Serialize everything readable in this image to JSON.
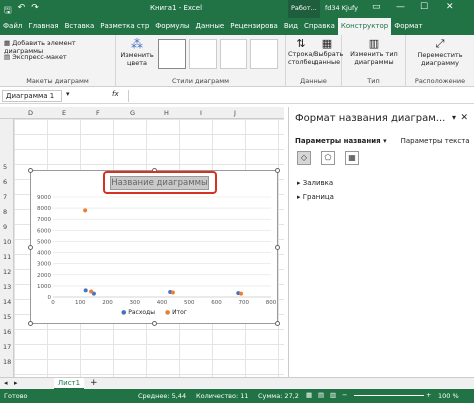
{
  "title": {
    "autosave_icon": "save-icon",
    "center": "Книга1 - Excel",
    "context_group": "Работ...",
    "user": "fd34 Kjufy",
    "controls": [
      "—",
      "☐",
      "✕"
    ]
  },
  "tabs": [
    "Файл",
    "Главная",
    "Вставка",
    "Разметка стр",
    "Формулы",
    "Данные",
    "Рецензирова",
    "Вид",
    "Справка",
    "Конструктор",
    "Формат"
  ],
  "active_tab": "Конструктор",
  "ribbon": {
    "add_element": "Добавить элемент диаграммы",
    "express_layout": "Экспресс-макет",
    "group_layouts": "Макеты диаграмм",
    "change_colors": "Изменить цвета",
    "group_styles": "Стили диаграмм",
    "switch_row_col": "Строка/ столбец",
    "select_data": "Выбрать данные",
    "group_data": "Данные",
    "change_type": "Изменить тип диаграммы",
    "group_type": "Тип",
    "move_chart": "Переместить диаграмму",
    "group_location": "Расположение"
  },
  "formula": {
    "namebox": "Диаграмма 1",
    "fx": "fx"
  },
  "columns": [
    "D",
    "E",
    "F",
    "G",
    "H",
    "I",
    "J"
  ],
  "rows": [
    "5",
    "6",
    "7",
    "8",
    "9",
    "10",
    "11",
    "12",
    "13",
    "14",
    "15",
    "16",
    "17",
    "18",
    "19",
    "20"
  ],
  "chart": {
    "title": "Название диаграммы",
    "legend": [
      "Расходы",
      "Итог"
    ],
    "colors": {
      "series1": "#4472c4",
      "series2": "#ed7d31"
    }
  },
  "chart_data": {
    "type": "scatter",
    "title": "Название диаграммы",
    "xlim": [
      0,
      800
    ],
    "ylim": [
      0,
      9000
    ],
    "xticks": [
      "0",
      "100",
      "200",
      "300",
      "400",
      "500",
      "600",
      "700",
      "800"
    ],
    "yticks": [
      "0",
      "1000",
      "2000",
      "3000",
      "4000",
      "5000",
      "6000",
      "7000",
      "8000",
      "9000"
    ],
    "series": [
      {
        "name": "Расходы",
        "color": "#4472c4",
        "points": [
          [
            120,
            600
          ],
          [
            150,
            300
          ],
          [
            430,
            450
          ],
          [
            680,
            350
          ]
        ]
      },
      {
        "name": "Итог",
        "color": "#ed7d31",
        "points": [
          [
            118,
            7800
          ],
          [
            140,
            500
          ],
          [
            440,
            400
          ],
          [
            690,
            300
          ]
        ]
      }
    ],
    "legend_position": "bottom"
  },
  "pane": {
    "title": "Формат названия диаграм...",
    "tab1": "Параметры названия",
    "tab2": "Параметры текста",
    "section1": "Заливка",
    "section2": "Граница"
  },
  "sheet": {
    "tab": "Лист1",
    "add": "+"
  },
  "status": {
    "ready": "Готово",
    "avg": "Среднее: 5,44",
    "count": "Количество: 11",
    "sum": "Сумма: 27,2",
    "zoom": "100 %"
  }
}
